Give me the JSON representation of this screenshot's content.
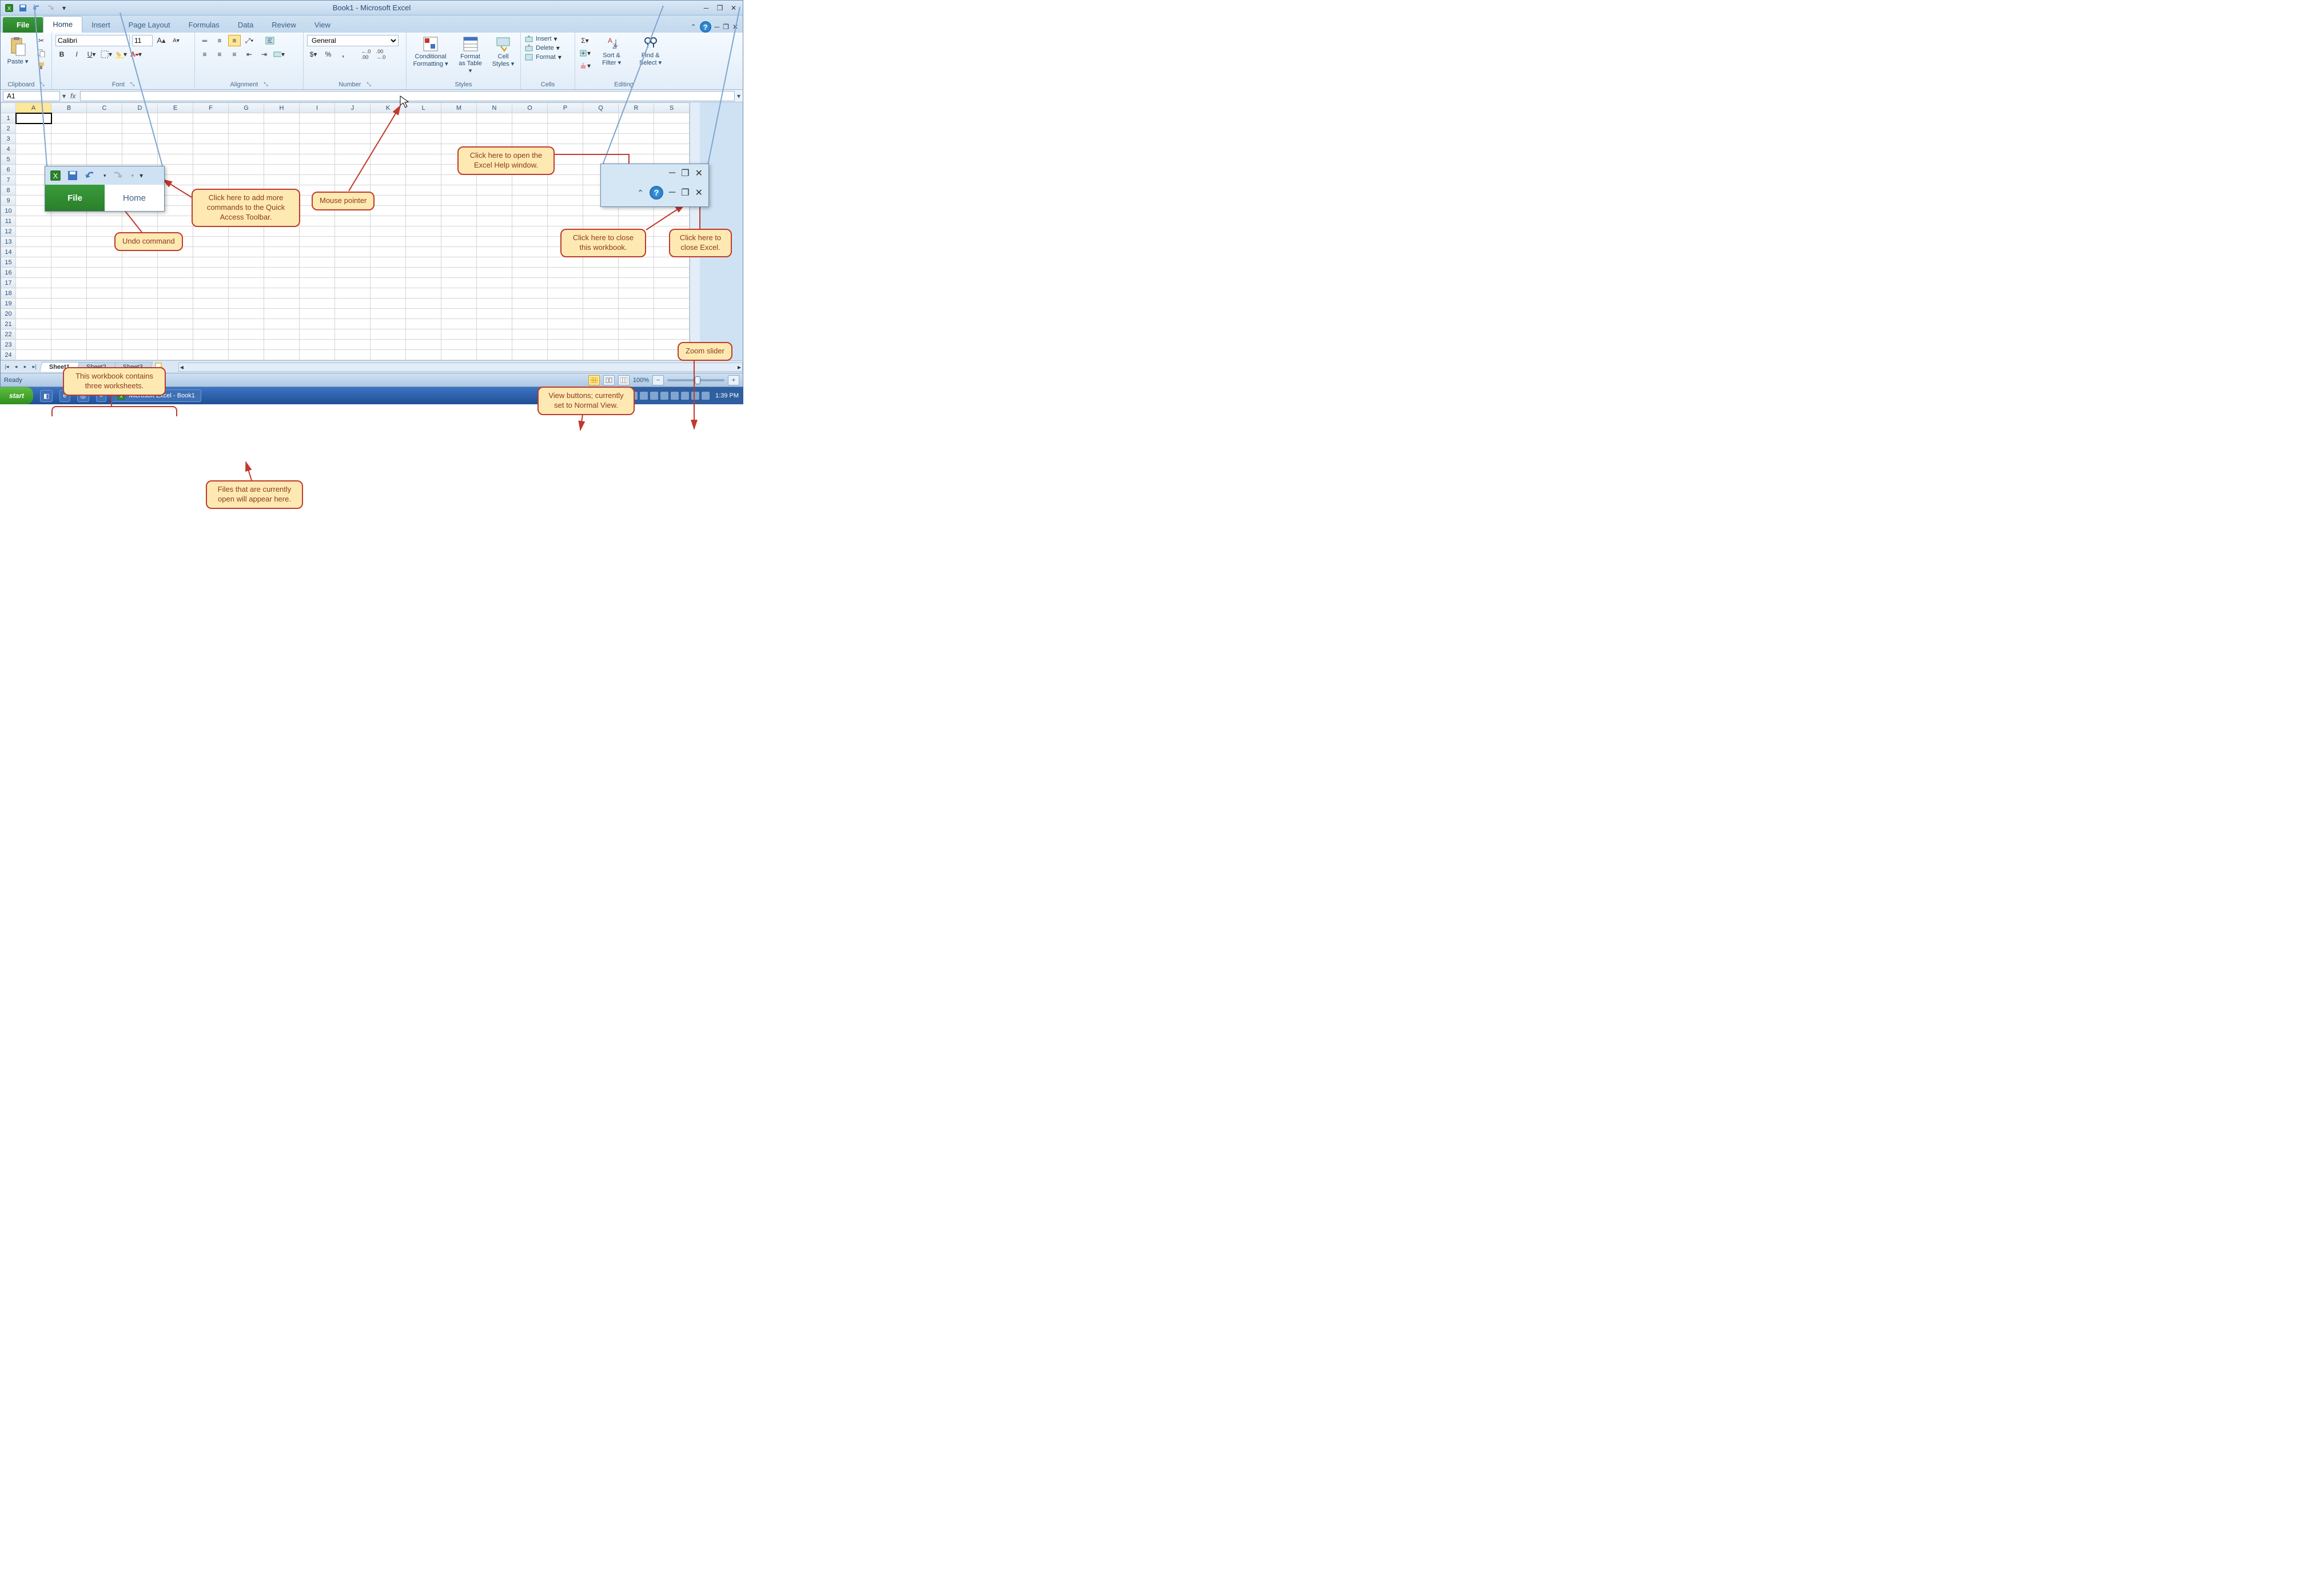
{
  "title": "Book1 - Microsoft Excel",
  "tabs": {
    "file": "File",
    "home": "Home",
    "insert": "Insert",
    "page_layout": "Page Layout",
    "formulas": "Formulas",
    "data": "Data",
    "review": "Review",
    "view": "View"
  },
  "ribbon": {
    "clipboard": {
      "paste": "Paste",
      "label": "Clipboard"
    },
    "font": {
      "name": "Calibri",
      "size": "11",
      "label": "Font"
    },
    "alignment": {
      "label": "Alignment"
    },
    "number": {
      "format": "General",
      "label": "Number"
    },
    "styles": {
      "cond": "Conditional Formatting",
      "table": "Format as Table",
      "cell": "Cell Styles",
      "label": "Styles"
    },
    "cells": {
      "insert": "Insert",
      "delete": "Delete",
      "format": "Format",
      "label": "Cells"
    },
    "editing": {
      "sort": "Sort & Filter",
      "find": "Find & Select",
      "label": "Editing"
    }
  },
  "namebox": "A1",
  "columns": [
    "A",
    "B",
    "C",
    "D",
    "E",
    "F",
    "G",
    "H",
    "I",
    "J",
    "K",
    "L",
    "M",
    "N",
    "O",
    "P",
    "Q",
    "R",
    "S"
  ],
  "rows": [
    1,
    2,
    3,
    4,
    5,
    6,
    7,
    8,
    9,
    10,
    11,
    12,
    13,
    14,
    15,
    16,
    17,
    18,
    19,
    20,
    21,
    22,
    23,
    24
  ],
  "sheets": [
    "Sheet1",
    "Sheet2",
    "Sheet3"
  ],
  "status": {
    "ready": "Ready",
    "zoom": "100%"
  },
  "taskbar": {
    "start": "start",
    "item": "Microsoft Excel - Book1",
    "time": "1:39 PM"
  },
  "callouts": {
    "help": "Click here to open the Excel Help window.",
    "qat": "Click here to add more commands to the Quick Access Toolbar.",
    "undo": "Undo command",
    "pointer": "Mouse pointer",
    "close_wb": "Click here to close this workbook.",
    "close_excel": "Click here to close Excel.",
    "zoom": "Zoom slider",
    "view": "View buttons; currently set to Normal View.",
    "sheets": "This workbook contains three worksheets.",
    "files": "Files that are currently open will appear here."
  },
  "inset": {
    "file": "File",
    "home": "Home"
  }
}
